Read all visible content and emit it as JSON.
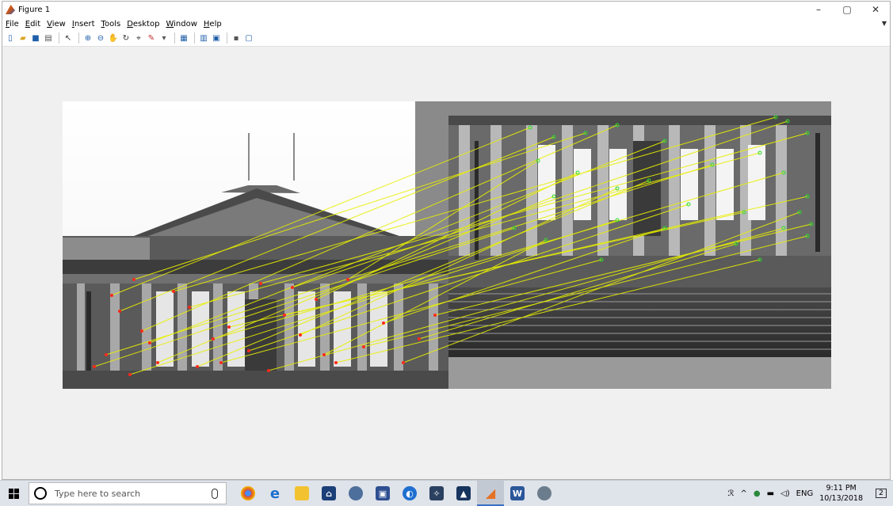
{
  "window": {
    "title": "Figure 1",
    "controls": {
      "minimize": "–",
      "maximize": "▢",
      "close": "✕"
    }
  },
  "menubar": {
    "items": [
      "File",
      "Edit",
      "View",
      "Insert",
      "Tools",
      "Desktop",
      "Window",
      "Help"
    ]
  },
  "toolbar": {
    "buttons": [
      "new-figure-icon",
      "open-file-icon",
      "save-icon",
      "print-icon",
      "pointer-icon",
      "zoom-in-icon",
      "zoom-out-icon",
      "pan-icon",
      "rotate-3d-icon",
      "data-cursor-icon",
      "brush-icon",
      "link-plot-icon",
      "insert-colorbar-icon",
      "insert-legend-icon",
      "hide-plot-tools-icon",
      "show-plot-tools-icon"
    ]
  },
  "figure": {
    "description_colors": {
      "matched_line": "#e8f000",
      "left_point": "#ff2a1a",
      "right_point": "#2bdc2b"
    }
  },
  "taskbar": {
    "search_placeholder": "Type here to search",
    "apps": [
      "chrome-icon",
      "edge-icon",
      "file-explorer-icon",
      "store-icon",
      "steam-icon",
      "app-icon",
      "app2-icon",
      "app3-icon",
      "photos-icon",
      "matlab-icon",
      "word-icon",
      "app4-icon"
    ],
    "tray": {
      "lang": "ENG",
      "time": "9:11 PM",
      "date": "10/13/2018",
      "notifications": "2"
    }
  }
}
